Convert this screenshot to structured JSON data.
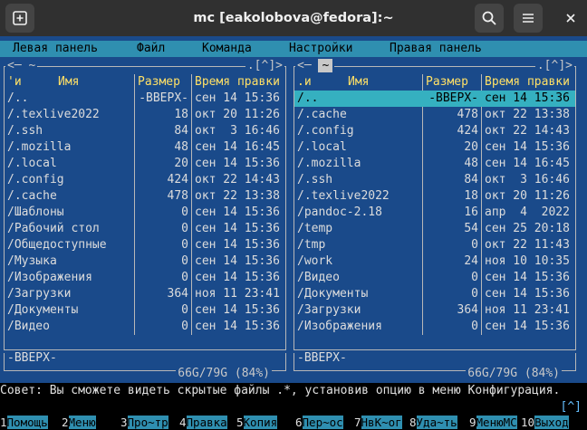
{
  "window": {
    "title": "mc [eakolobova@fedora]:~",
    "icons": [
      "new-tab-icon",
      "search-icon",
      "hamburger-menu-icon",
      "close-icon"
    ]
  },
  "menubar": {
    "items": [
      "Левая панель",
      "Файл",
      "Команда",
      "Настройки",
      "Правая панель"
    ]
  },
  "left_panel": {
    "path": "~",
    "top_right": ".[^]>",
    "headers": {
      "name_marker": "'и",
      "name": "Имя",
      "size": "Размер",
      "time": "Время правки"
    },
    "rows": [
      {
        "name": "/..",
        "size": "-ВВЕРХ-",
        "time": "сен 14 15:36"
      },
      {
        "name": "/.texlive2022",
        "size": "18",
        "time": "окт 20 11:26"
      },
      {
        "name": "/.ssh",
        "size": "84",
        "time": "окт  3 16:46"
      },
      {
        "name": "/.mozilla",
        "size": "48",
        "time": "сен 14 16:45"
      },
      {
        "name": "/.local",
        "size": "20",
        "time": "сен 14 15:36"
      },
      {
        "name": "/.config",
        "size": "424",
        "time": "окт 22 14:43"
      },
      {
        "name": "/.cache",
        "size": "478",
        "time": "окт 22 13:38"
      },
      {
        "name": "/Шаблоны",
        "size": "0",
        "time": "сен 14 15:36"
      },
      {
        "name": "/Рабочий стол",
        "size": "0",
        "time": "сен 14 15:36"
      },
      {
        "name": "/Общедоступные",
        "size": "0",
        "time": "сен 14 15:36"
      },
      {
        "name": "/Музыка",
        "size": "0",
        "time": "сен 14 15:36"
      },
      {
        "name": "/Изображения",
        "size": "0",
        "time": "сен 14 15:36"
      },
      {
        "name": "/Загрузки",
        "size": "364",
        "time": "ноя 11 23:41"
      },
      {
        "name": "/Документы",
        "size": "0",
        "time": "сен 14 15:36"
      },
      {
        "name": "/Видео",
        "size": "0",
        "time": "сен 14 15:36"
      }
    ],
    "mini_status": "-ВВЕРХ-",
    "disk": "66G/79G (84%)"
  },
  "right_panel": {
    "path": "~",
    "top_right": ".[^]>",
    "headers": {
      "name_marker": ".и",
      "name": "Имя",
      "size": "Размер",
      "time": "Время правки"
    },
    "rows": [
      {
        "name": "/..",
        "size": "-ВВЕРХ-",
        "time": "сен 14 15:36"
      },
      {
        "name": "/.cache",
        "size": "478",
        "time": "окт 22 13:38"
      },
      {
        "name": "/.config",
        "size": "424",
        "time": "окт 22 14:43"
      },
      {
        "name": "/.local",
        "size": "20",
        "time": "сен 14 15:36"
      },
      {
        "name": "/.mozilla",
        "size": "48",
        "time": "сен 14 16:45"
      },
      {
        "name": "/.ssh",
        "size": "84",
        "time": "окт  3 16:46"
      },
      {
        "name": "/.texlive2022",
        "size": "18",
        "time": "окт 20 11:26"
      },
      {
        "name": "/pandoc-2.18",
        "size": "16",
        "time": "апр  4  2022"
      },
      {
        "name": "/temp",
        "size": "54",
        "time": "сен 25 20:18"
      },
      {
        "name": "/tmp",
        "size": "0",
        "time": "окт 22 11:43"
      },
      {
        "name": "/work",
        "size": "24",
        "time": "ноя 10 10:35"
      },
      {
        "name": "/Видео",
        "size": "0",
        "time": "сен 14 15:36"
      },
      {
        "name": "/Документы",
        "size": "0",
        "time": "сен 14 15:36"
      },
      {
        "name": "/Загрузки",
        "size": "364",
        "time": "ноя 11 23:41"
      },
      {
        "name": "/Изображения",
        "size": "0",
        "time": "сен 14 15:36"
      }
    ],
    "mini_status": "-ВВЕРХ-",
    "disk": "66G/79G (84%)"
  },
  "hint": "Совет: Вы сможете видеть скрытые файлы .*, установив опцию в меню Конфигурация.",
  "command_line": {
    "prompt": "$",
    "history_button": "[^]"
  },
  "fkeys": [
    {
      "n": "1",
      "label": "Помощь"
    },
    {
      "n": "2",
      "label": "Меню"
    },
    {
      "n": "3",
      "label": "Про~тр"
    },
    {
      "n": "4",
      "label": "Правка"
    },
    {
      "n": "5",
      "label": "Копия"
    },
    {
      "n": "6",
      "label": "Пер~ос"
    },
    {
      "n": "7",
      "label": "НвК~ог"
    },
    {
      "n": "8",
      "label": "Уда~ть"
    },
    {
      "n": "9",
      "label": "МенюМС"
    },
    {
      "n": "10",
      "label": "Выход"
    }
  ],
  "colors": {
    "panel_bg": "#1a4a8a",
    "menubar_bg": "#2f8fb0",
    "selection_bg": "#35b0c0",
    "header_fg": "#ffe066"
  }
}
